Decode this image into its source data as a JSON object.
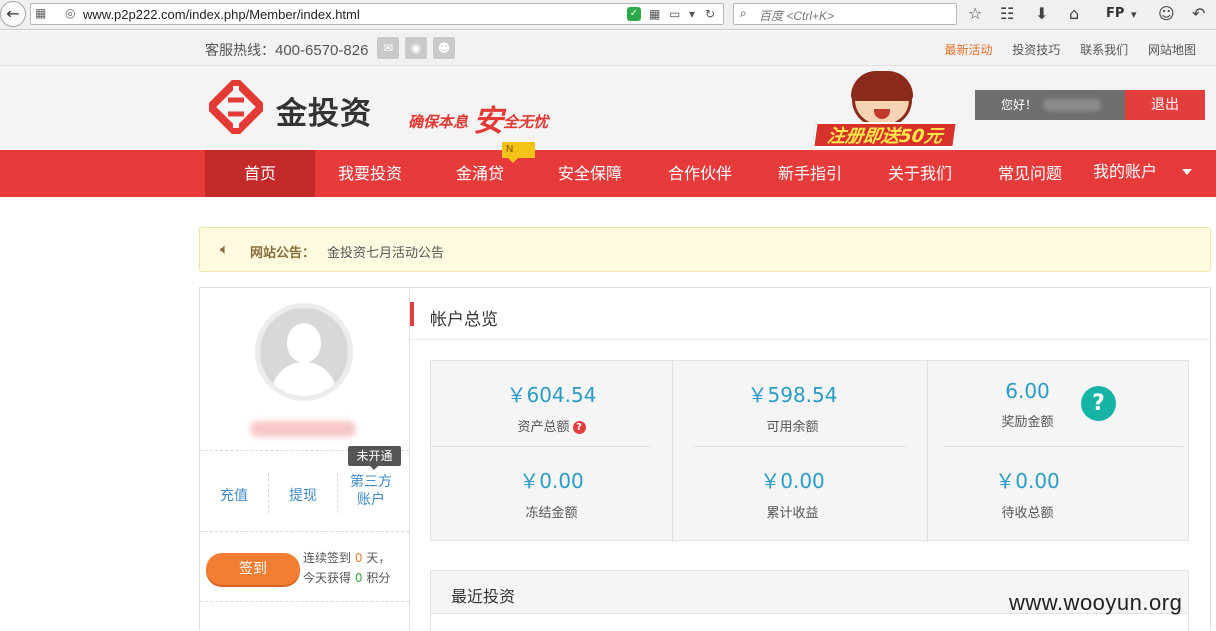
{
  "browser": {
    "url": "www.p2p222.com/index.php/Member/index.html",
    "search_placeholder": "百度 <Ctrl+K>",
    "fp_label": "FP"
  },
  "topbar": {
    "hotline_label": "客服热线：",
    "hotline_number": "400-6570-826",
    "links": [
      "最新活动",
      "投资技巧",
      "联系我们",
      "网站地图"
    ]
  },
  "header": {
    "logo_text": "金投资",
    "slogan_a": "确保本息",
    "slogan_big": "安",
    "slogan_b": "全无忧",
    "promo_text": "注册即送50元",
    "greeting": "您好！",
    "logout": "退出"
  },
  "nav": {
    "items": [
      "首页",
      "我要投资",
      "金涌贷",
      "安全保障",
      "合作伙伴",
      "新手指引",
      "关于我们",
      "常见问题",
      "我的账户"
    ],
    "badge": "N",
    "active_index": 0
  },
  "notice": {
    "label": "网站公告：",
    "text": "金投资七月活动公告"
  },
  "profile": {
    "actions": [
      "充值",
      "提现",
      "第三方账户"
    ],
    "third_line1": "第三方",
    "third_line2": "账户",
    "tooltip": "未开通",
    "signin_button": "签到",
    "sign_line1_prefix": "连续签到",
    "sign_days": "0",
    "sign_line1_suffix": "天，",
    "sign_line2_prefix": "今天获得",
    "sign_points": "0",
    "sign_line2_suffix": "积分"
  },
  "overview": {
    "title": "帐户总览",
    "stats": [
      {
        "value": "￥604.54",
        "label": "资产总额",
        "help": true
      },
      {
        "value": "￥598.54",
        "label": "可用余额"
      },
      {
        "value": "6.00",
        "label": "奖励金额"
      },
      {
        "value": "￥0.00",
        "label": "冻结金额"
      },
      {
        "value": "￥0.00",
        "label": "累计收益"
      },
      {
        "value": "￥0.00",
        "label": "待收总额"
      }
    ],
    "help_symbol": "?",
    "recent_title": "最近投资"
  },
  "watermark": "www.wooyun.org",
  "colors": {
    "brand_red": "#e73b3b",
    "value_blue": "#2a9cc5",
    "signin_orange": "#f27d33",
    "help_teal": "#16b3a7"
  }
}
